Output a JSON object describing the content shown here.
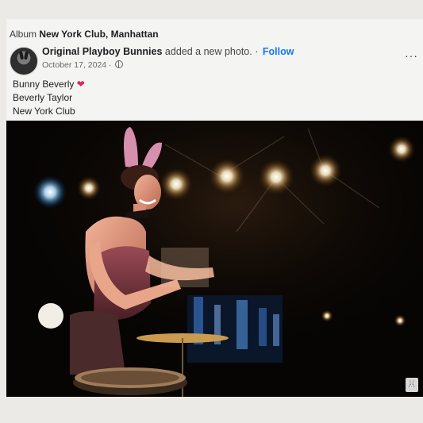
{
  "post": {
    "album_prefix": "Album",
    "album_name": "New York Club, Manhattan",
    "author": "Original Playboy Bunnies",
    "action": "added a new photo.",
    "separator": "·",
    "follow_label": "Follow",
    "date": "October 17, 2024 ·",
    "more_label": "···",
    "caption": {
      "line1": "Bunny Beverly",
      "heart": "❤",
      "line2": "Beverly Taylor",
      "line3": "New York Club"
    }
  },
  "icons": {
    "avatar": "playboy-bunny-avatar",
    "audience": "globe-icon",
    "more": "more-options-icon",
    "watermark": "playboy-bunny-logo"
  },
  "colors": {
    "link": "#1877f2",
    "heart": "#e0245e",
    "text": "#1c1e21",
    "muted": "#65676b"
  }
}
